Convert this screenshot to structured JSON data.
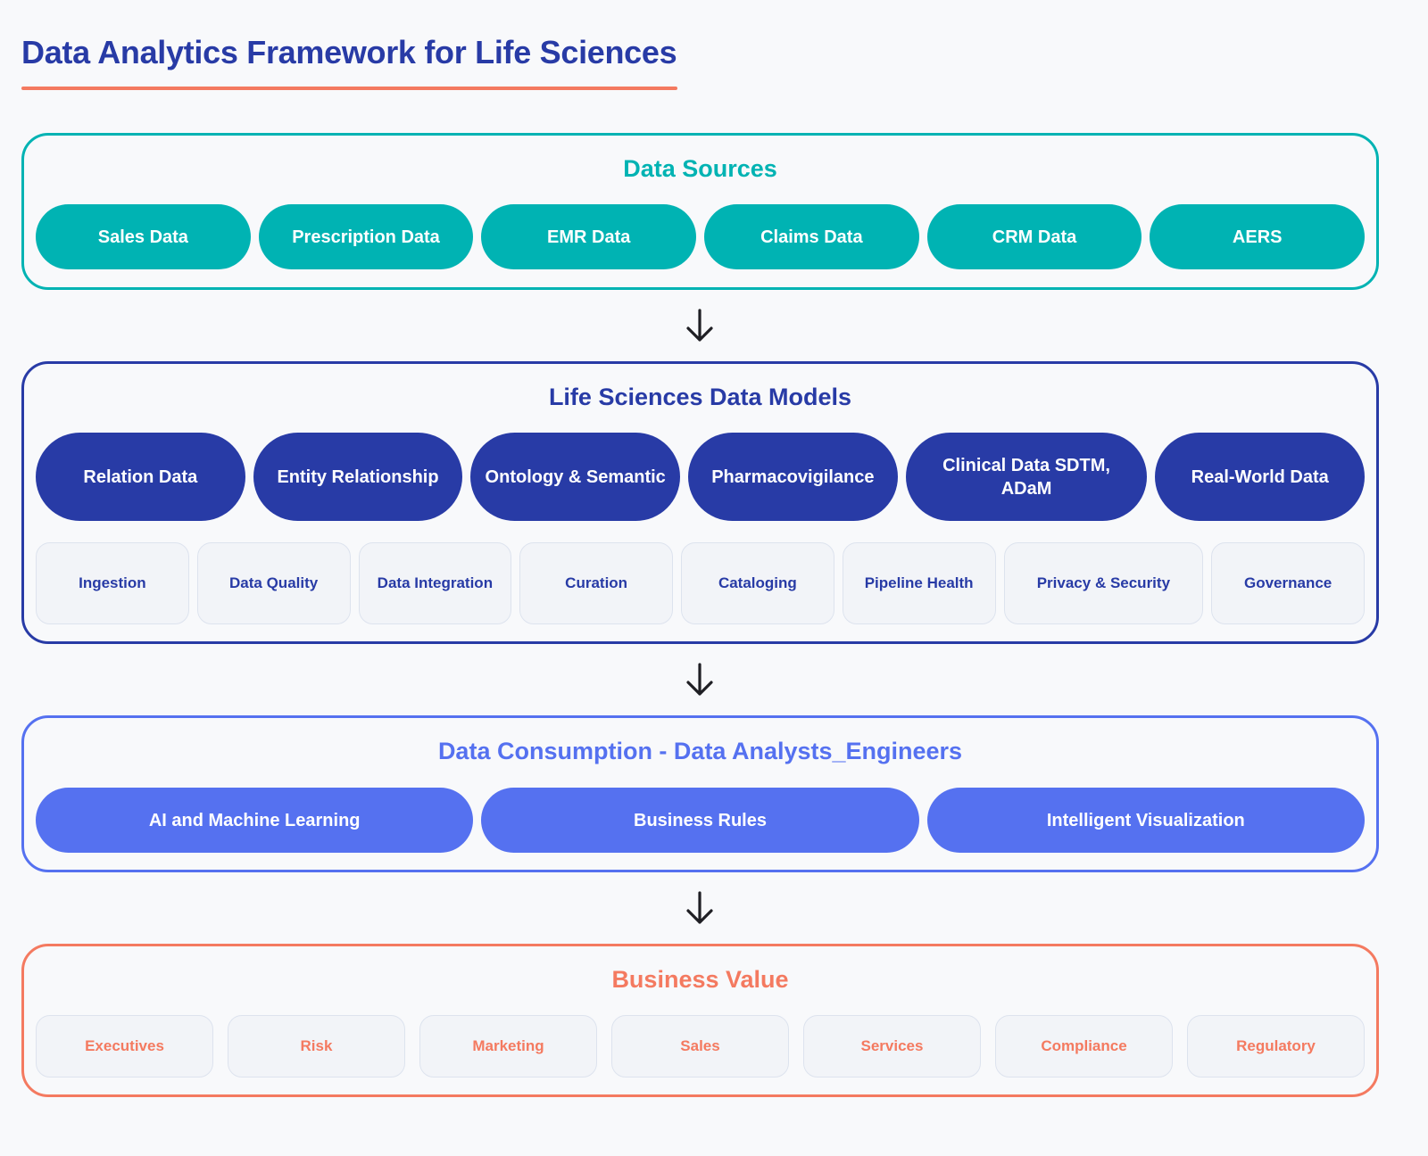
{
  "page": {
    "title": "Data Analytics Framework for Life Sciences"
  },
  "colors": {
    "title": "#283BA6",
    "accent_underline": "#F47A60",
    "sources": "#00B3B3",
    "models": "#283BA6",
    "consumption": "#5571F0",
    "value": "#F47A60",
    "arrow": "#1F1F24",
    "card_bg": "#F2F4F8",
    "page_bg": "#F8F9FB"
  },
  "data_sources": {
    "heading": "Data Sources",
    "items": [
      "Sales Data",
      "Prescription Data",
      "EMR Data",
      "Claims Data",
      "CRM Data",
      "AERS"
    ]
  },
  "data_models": {
    "heading": "Life Sciences Data Models",
    "models": [
      "Relation Data",
      "Entity Relationship",
      "Ontology & Semantic",
      "Pharmacovigilance",
      "Clinical Data SDTM, ADaM",
      "Real-World Data"
    ],
    "capabilities": [
      "Ingestion",
      "Data Quality",
      "Data Integration",
      "Curation",
      "Cataloging",
      "Pipeline Health",
      "Privacy & Security",
      "Governance"
    ]
  },
  "data_consumption": {
    "heading": "Data Consumption - Data Analysts_Engineers",
    "items": [
      "AI and Machine Learning",
      "Business Rules",
      "Intelligent Visualization"
    ]
  },
  "business_value": {
    "heading": "Business Value",
    "items": [
      "Executives",
      "Risk",
      "Marketing",
      "Sales",
      "Services",
      "Compliance",
      "Regulatory"
    ]
  },
  "flow_arrows": [
    {
      "from": "Data Sources",
      "to": "Life Sciences Data Models",
      "icon": "arrow-down-icon"
    },
    {
      "from": "Life Sciences Data Models",
      "to": "Data Consumption - Data Analysts_Engineers",
      "icon": "arrow-down-icon"
    },
    {
      "from": "Data Consumption - Data Analysts_Engineers",
      "to": "Business Value",
      "icon": "arrow-down-icon"
    }
  ]
}
